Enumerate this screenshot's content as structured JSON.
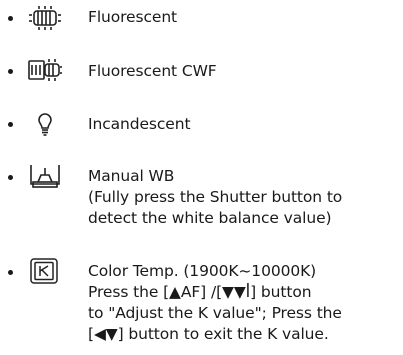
{
  "items": [
    {
      "icon": "fluorescent-icon",
      "lines": [
        "Fluorescent"
      ]
    },
    {
      "icon": "fluorescent-cwf-icon",
      "lines": [
        "Fluorescent CWF"
      ]
    },
    {
      "icon": "incandescent-bulb-icon",
      "lines": [
        "Incandescent"
      ]
    },
    {
      "icon": "manual-wb-icon",
      "lines": [
        "Manual WB",
        "(Fully press the Shutter button to",
        "detect the white balance value)"
      ]
    },
    {
      "icon": "color-temp-k-icon",
      "lines": [
        "Color Temp. (1900K~10000K)",
        "Press the [▲AF] /[▼▼ꟾ] button",
        "to \"Adjust the K value\"; Press the",
        "[◀▼] button to exit the K value."
      ]
    }
  ]
}
